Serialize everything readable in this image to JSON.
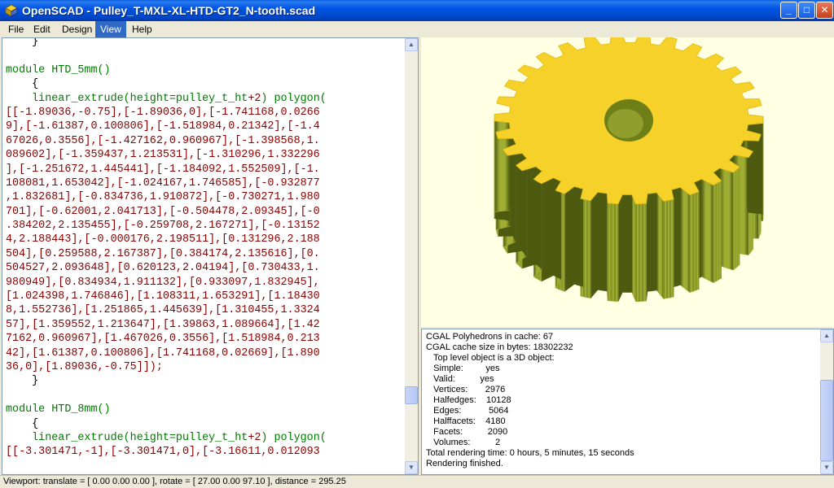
{
  "window": {
    "app_name": "OpenSCAD",
    "title": "OpenSCAD - Pulley_T-MXL-XL-HTD-GT2_N-tooth.scad",
    "minimize_glyph": "_",
    "maximize_glyph": "□",
    "close_glyph": "✕"
  },
  "menu": {
    "items": [
      "File",
      "Edit",
      "Design",
      "View",
      "Help"
    ],
    "active": "View"
  },
  "editor": {
    "lines": [
      "    }",
      "",
      "module HTD_5mm()",
      "    {",
      "    linear_extrude(height=pulley_t_ht+2) polygon(",
      "[[-1.89036,-0.75],[-1.89036,0],[-1.741168,0.0266",
      "9],[-1.61387,0.100806],[-1.518984,0.21342],[-1.4",
      "67026,0.3556],[-1.427162,0.960967],[-1.398568,1.",
      "089602],[-1.359437,1.213531],[-1.310296,1.332296",
      "],[-1.251672,1.445441],[-1.184092,1.552509],[-1.",
      "108081,1.653042],[-1.024167,1.746585],[-0.932877",
      ",1.832681],[-0.834736,1.910872],[-0.730271,1.980",
      "701],[-0.62001,2.041713],[-0.504478,2.09345],[-0",
      ".384202,2.135455],[-0.259708,2.167271],[-0.13152",
      "4,2.188443],[-0.000176,2.198511],[0.131296,2.188",
      "504],[0.259588,2.167387],[0.384174,2.135616],[0.",
      "504527,2.093648],[0.620123,2.04194],[0.730433,1.",
      "980949],[0.834934,1.911132],[0.933097,1.832945],",
      "[1.024398,1.746846],[1.108311,1.653291],[1.18430",
      "8,1.552736],[1.251865,1.445639],[1.310455,1.3324",
      "57],[1.359552,1.213647],[1.39863,1.089664],[1.42",
      "7162,0.960967],[1.467026,0.3556],[1.518984,0.213",
      "42],[1.61387,0.100806],[1.741168,0.02669],[1.890",
      "36,0],[1.89036,-0.75]]);",
      "    }",
      "",
      "module HTD_8mm()",
      "    {",
      "    linear_extrude(height=pulley_t_ht+2) polygon(",
      "[[-3.301471,-1],[-3.301471,0],[-3.16611,0.012093"
    ]
  },
  "console": {
    "lines": [
      "CGAL Polyhedrons in cache: 67",
      "CGAL cache size in bytes: 18302232",
      "   Top level object is a 3D object:",
      "   Simple:         yes",
      "   Valid:          yes",
      "   Vertices:       2976",
      "   Halfedges:    10128",
      "   Edges:           5064",
      "   Halffacets:    4180",
      "   Facets:          2090",
      "   Volumes:          2",
      "Total rendering time: 0 hours, 5 minutes, 15 seconds",
      "Rendering finished."
    ]
  },
  "status": {
    "text": "Viewport: translate = [ 0.00 0.00 0.00 ], rotate = [ 27.00 0.00 97.10 ], distance = 295.25"
  },
  "scrollbar_glyphs": {
    "up": "▲",
    "down": "▼"
  },
  "model": {
    "teeth": 30,
    "top_color": "#f5d12a",
    "side_color_light": "#9fae33",
    "side_color_dark": "#4d5a10",
    "bore_color": "#6f7f18"
  }
}
